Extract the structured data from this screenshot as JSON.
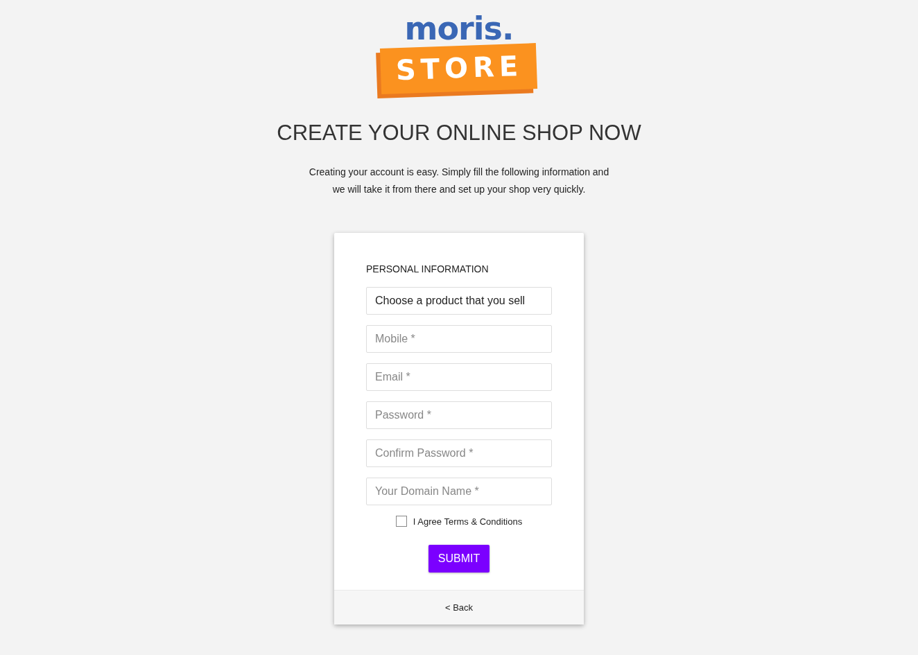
{
  "logo": {
    "word": "moris.",
    "banner": "STORE"
  },
  "title": "CREATE YOUR ONLINE SHOP NOW",
  "intro": [
    "Creating your account is easy. Simply fill the following information and",
    "we will take it from there and set up your shop very quickly."
  ],
  "form": {
    "section": "PERSONAL INFORMATION",
    "fields": [
      {
        "value": "Choose a product that you sell"
      },
      {
        "placeholder": "Mobile *"
      },
      {
        "placeholder": "Email *"
      },
      {
        "placeholder": "Password *"
      },
      {
        "placeholder": "Confirm Password *"
      },
      {
        "placeholder": "Your Domain Name *"
      }
    ],
    "agree": {
      "label": "I Agree Terms & Conditions",
      "checked": false
    },
    "submit": "SUBMIT"
  },
  "footer": {
    "back": "< Back"
  }
}
